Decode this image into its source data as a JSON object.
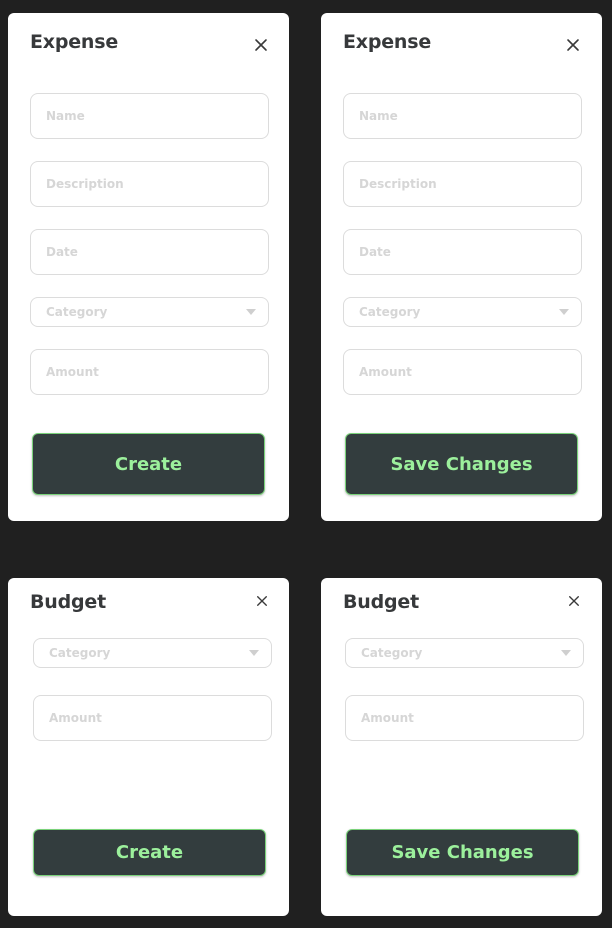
{
  "colors": {
    "background": "#202020",
    "card": "#ffffff",
    "button_bg": "#333d3e",
    "button_text": "#9cf09c",
    "button_border": "#7ad27a",
    "title_text": "#37393b",
    "placeholder": "#d6d6d6"
  },
  "expense_create": {
    "title": "Expense",
    "close_icon": "close-icon",
    "name_placeholder": "Name",
    "description_placeholder": "Description",
    "date_placeholder": "Date",
    "category_placeholder": "Category",
    "amount_placeholder": "Amount",
    "button_label": "Create"
  },
  "expense_edit": {
    "title": "Expense",
    "close_icon": "close-icon",
    "name_placeholder": "Name",
    "description_placeholder": "Description",
    "date_placeholder": "Date",
    "category_placeholder": "Category",
    "amount_placeholder": "Amount",
    "button_label": "Save Changes"
  },
  "budget_create": {
    "title": "Budget",
    "close_icon": "close-icon",
    "category_placeholder": "Category",
    "amount_placeholder": "Amount",
    "button_label": "Create"
  },
  "budget_edit": {
    "title": "Budget",
    "close_icon": "close-icon",
    "category_placeholder": "Category",
    "amount_placeholder": "Amount",
    "button_label": "Save Changes"
  }
}
